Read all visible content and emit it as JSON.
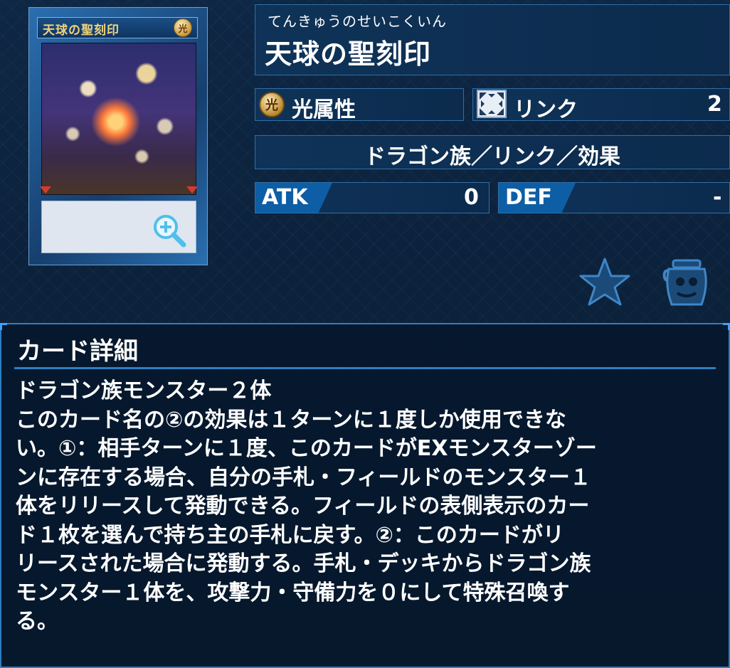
{
  "card": {
    "image_name": "天球の聖刻印",
    "image_attribute": "光"
  },
  "header": {
    "furigana": "てんきゅうのせいこくいん",
    "title": "天球の聖刻印"
  },
  "stats": {
    "attribute_icon": "光",
    "attribute": "光属性",
    "link_label": "リンク",
    "link_value": "2",
    "type_line": "ドラゴン族／リンク／効果",
    "atk_label": "ATK",
    "atk_value": "0",
    "def_label": "DEF",
    "def_value": "-"
  },
  "actions": {
    "favorite_icon": "star-icon",
    "deck_icon": "jar-icon"
  },
  "detail": {
    "heading": "カード詳細",
    "text": "ドラゴン族モンスター２体\nこのカード名の②の効果は１ターンに１度しか使用できな\nい。①：相手ターンに１度、このカードがEXモンスターゾー\nンに存在する場合、自分の手札・フィールドのモンスター１\n体をリリースして発動できる。フィールドの表側表示のカー\nド１枚を選んで持ち主の手札に戻す。②：このカードがリ\nリースされた場合に発動する。手札・デッキからドラゴン族\nモンスター１体を、攻撃力・守備力を０にして特殊召喚す\nる。"
  },
  "colors": {
    "background": "#0b1d33",
    "panel": "#0f3358",
    "accent": "#2e7fc2",
    "tag": "#0e5ea6"
  }
}
